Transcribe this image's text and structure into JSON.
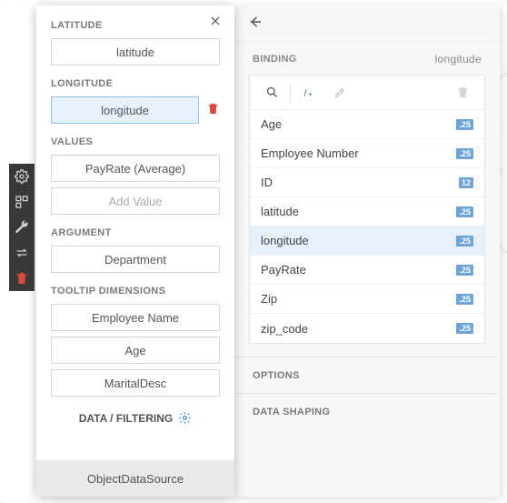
{
  "toolstrip": {
    "tools": [
      "gear-icon",
      "layout-icon",
      "wrench-icon",
      "swap-icon",
      "trash-icon"
    ]
  },
  "leftPanel": {
    "sections": {
      "latitude": {
        "label": "LATITUDE",
        "value": "latitude"
      },
      "longitude": {
        "label": "LONGITUDE",
        "value": "longitude"
      },
      "values": {
        "label": "VALUES",
        "value": "PayRate (Average)",
        "add": "Add Value"
      },
      "argument": {
        "label": "ARGUMENT",
        "value": "Department"
      },
      "tooltip": {
        "label": "TOOLTIP DIMENSIONS",
        "items": [
          "Employee Name",
          "Age",
          "MaritalDesc"
        ]
      }
    },
    "dataFiltering": "DATA / FILTERING",
    "dataSource": "ObjectDataSource"
  },
  "rightPanel": {
    "bindingLabel": "BINDING",
    "bindingHint": "longitude",
    "items": [
      {
        "name": "Age",
        "badge": ".25"
      },
      {
        "name": "Employee Number",
        "badge": ".25"
      },
      {
        "name": "ID",
        "badge": "12"
      },
      {
        "name": "latitude",
        "badge": ".25"
      },
      {
        "name": "longitude",
        "badge": ".25"
      },
      {
        "name": "PayRate",
        "badge": ".25"
      },
      {
        "name": "Zip",
        "badge": ".25"
      },
      {
        "name": "zip_code",
        "badge": ".25"
      }
    ],
    "optionsLabel": "OPTIONS",
    "dataShapingLabel": "DATA SHAPING"
  }
}
